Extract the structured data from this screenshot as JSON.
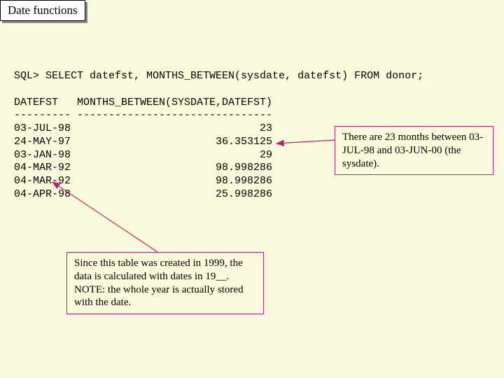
{
  "title": "Date functions",
  "sql_cmd": "SQL> SELECT datefst, MONTHS_BETWEEN(sysdate, datefst) FROM donor;",
  "col_header": "DATEFST   MONTHS_BETWEEN(SYSDATE,DATEFST)",
  "dashes": "--------- -------------------------------",
  "rows": [
    {
      "d": "03-JUL-98",
      "v": "23"
    },
    {
      "d": "24-MAY-97",
      "v": "36.353125"
    },
    {
      "d": "03-JAN-98",
      "v": "29"
    },
    {
      "d": "04-MAR-92",
      "v": "98.998286"
    },
    {
      "d": "04-MAR-92",
      "v": "98.998286"
    },
    {
      "d": "04-APR-98",
      "v": "25.998286"
    }
  ],
  "note_right": "There are 23 months between 03-JUL-98 and 03-JUN-00 (the sysdate).",
  "note_bottom": "Since this table was created in 1999, the data is calculated with dates in 19__.  NOTE: the whole year is actually stored with the date."
}
